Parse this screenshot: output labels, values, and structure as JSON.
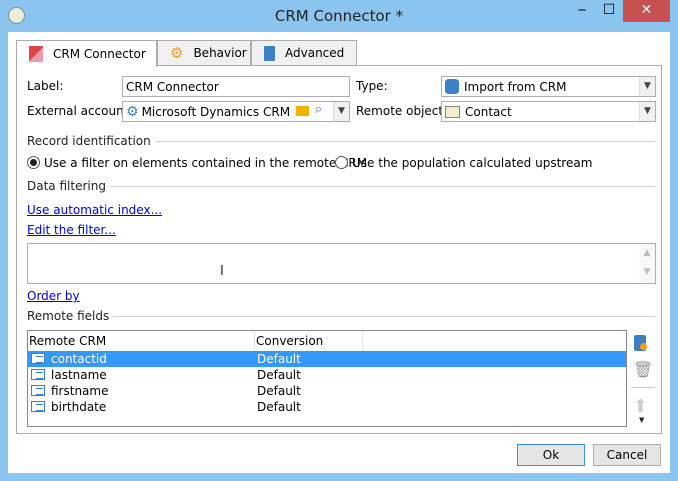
{
  "window": {
    "title": "CRM Connector *",
    "minimize": "‒",
    "maximize": "☐",
    "close": "✕"
  },
  "tabs": [
    {
      "label": "CRM Connector"
    },
    {
      "label": "Behavior"
    },
    {
      "label": "Advanced"
    }
  ],
  "form": {
    "label_label": "Label:",
    "label_value": "CRM Connector",
    "type_label": "Type:",
    "type_value": "Import from CRM",
    "external_account_label": "External account:",
    "external_account_value": "Microsoft Dynamics CRM",
    "remote_object_label": "Remote object:",
    "remote_object_value": "Contact"
  },
  "record_identification": {
    "title": "Record identification",
    "options": [
      {
        "label": "Use a filter on elements contained in the remote CRM",
        "selected": true
      },
      {
        "label": "Use the population calculated upstream",
        "selected": false
      }
    ]
  },
  "data_filtering": {
    "title": "Data filtering",
    "auto_index_link": "Use automatic index...",
    "edit_filter_link": "Edit the filter...",
    "order_by_link": "Order by"
  },
  "remote_fields": {
    "title": "Remote fields",
    "columns": [
      "Remote CRM",
      "Conversion"
    ],
    "rows": [
      {
        "name": "contactid",
        "conversion": "Default",
        "selected": true
      },
      {
        "name": "lastname",
        "conversion": "Default"
      },
      {
        "name": "firstname",
        "conversion": "Default"
      },
      {
        "name": "birthdate",
        "conversion": "Default"
      }
    ]
  },
  "buttons": {
    "ok": "Ok",
    "cancel": "Cancel"
  },
  "colors": {
    "frame": "#8cc4f0",
    "selection": "#3399ff",
    "close": "#c75050",
    "link": "#0000e0"
  }
}
